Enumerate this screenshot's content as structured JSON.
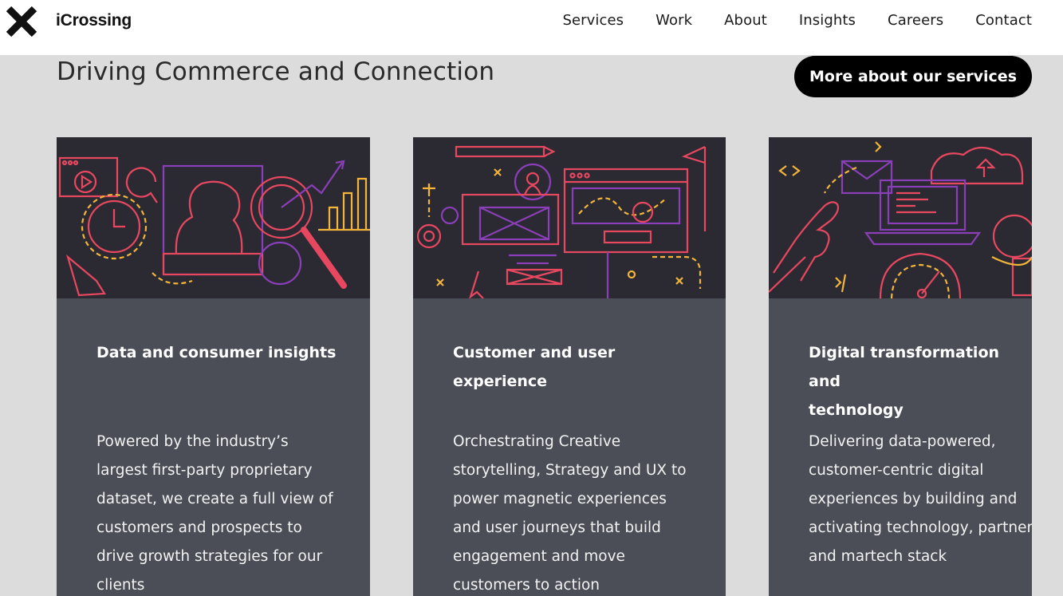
{
  "header": {
    "brand": "iCrossing",
    "logo_icon": "x-logo-icon",
    "nav": [
      "Services",
      "Work",
      "About",
      "Insights",
      "Careers",
      "Contact"
    ]
  },
  "hero": {
    "headline": "Driving Commerce and Connection",
    "cta_label": "More about our services"
  },
  "cards": [
    {
      "title": "Data and consumer insights",
      "body": "Powered by the industry’s\nlargest first-party proprietary\ndataset, we create a full view of\ncustomers and prospects to\ndrive growth strategies for our\nclients",
      "illustration": "data-insights-illustration"
    },
    {
      "title": "Customer and user\nexperience",
      "body": "Orchestrating Creative\nstorytelling, Strategy and UX to\npower magnetic experiences\nand user journeys that build\nengagement and move\ncustomers to action",
      "illustration": "customer-experience-illustration"
    },
    {
      "title": "Digital transformation and\ntechnology",
      "body": "Delivering data-powered,\ncustomer-centric digital\nexperiences by building and\nactivating technology, partners\nand martech stack",
      "illustration": "digital-technology-illustration"
    }
  ],
  "colors": {
    "page_bg": "#dcdcdc",
    "card_bg": "#4b4e57",
    "illustration_bg": "#2b2a33",
    "accent_red": "#e8485f",
    "accent_purple": "#8a3fb8",
    "accent_yellow": "#f2b53a"
  }
}
